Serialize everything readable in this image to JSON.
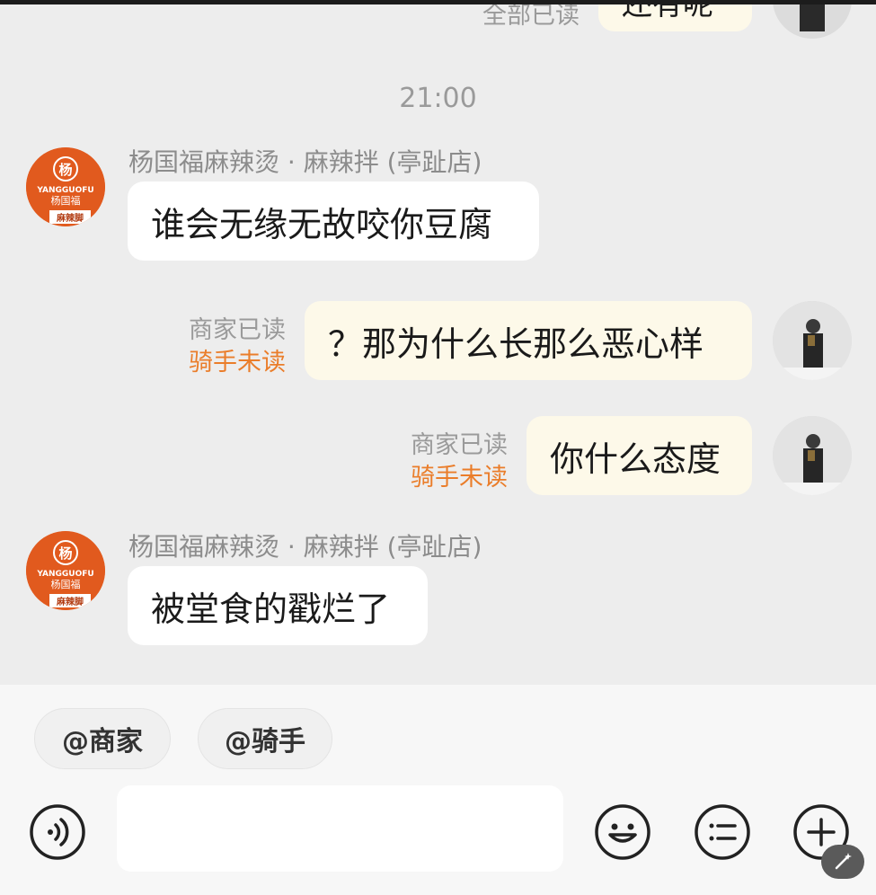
{
  "header_partial": {
    "status_text": "全部已读",
    "bubble_text": "还有呢"
  },
  "timestamp": "21:00",
  "messages": [
    {
      "side": "left",
      "sender": "杨国福麻辣烫 · 麻辣拌 (亭趾店)",
      "text": "谁会无缘无故咬你豆腐"
    },
    {
      "side": "right",
      "status_read": "商家已读",
      "status_unread": "骑手未读",
      "text": "？那为什么长那么恶心样"
    },
    {
      "side": "right",
      "status_read": "商家已读",
      "status_unread": "骑手未读",
      "text": "你什么态度"
    },
    {
      "side": "left",
      "sender": "杨国福麻辣烫 · 麻辣拌 (亭趾店)",
      "text": "被堂食的戳烂了"
    }
  ],
  "shop_logo": {
    "monogram": "杨",
    "brand_en": "YANGGUOFU",
    "brand_cn": "杨国福",
    "tag": "麻辣脚"
  },
  "quick_mentions": [
    "@商家",
    "@骑手"
  ],
  "input": {
    "placeholder": ""
  },
  "toolbar_icons": [
    "voice-icon",
    "emoji-icon",
    "quick-reply-icon",
    "plus-icon"
  ],
  "colors": {
    "unread": "#ea7d2a",
    "shop_brand": "#e15a1e",
    "my_bubble": "#fdf9e9"
  }
}
